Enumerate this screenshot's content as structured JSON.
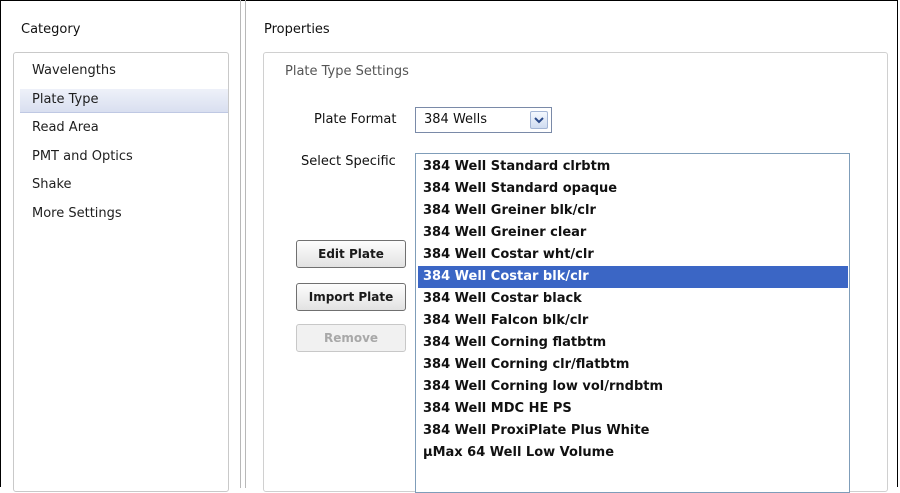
{
  "category": {
    "header": "Category",
    "items": [
      {
        "label": "Wavelengths"
      },
      {
        "label": "Plate Type",
        "selected": true
      },
      {
        "label": "Read Area"
      },
      {
        "label": "PMT and Optics"
      },
      {
        "label": "Shake"
      },
      {
        "label": "More Settings"
      }
    ]
  },
  "properties": {
    "header": "Properties",
    "section_title": "Plate Type Settings",
    "plate_format": {
      "label": "Plate Format",
      "value": "384 Wells",
      "icon": "chevron-down-icon"
    },
    "select_specific": {
      "label": "Select Specific",
      "selected_index": 5,
      "items": [
        "384 Well Standard clrbtm",
        "384 Well Standard opaque",
        "384 Well Greiner blk/clr",
        "384 Well Greiner clear",
        "384 Well Costar wht/clr",
        "384 Well Costar blk/clr",
        "384 Well Costar black",
        "384 Well Falcon blk/clr",
        "384 Well Corning flatbtm",
        "384 Well Corning clr/flatbtm",
        "384 Well Corning low vol/rndbtm",
        "384 Well MDC HE PS",
        "384 Well ProxiPlate Plus White",
        "µMax 64 Well Low Volume"
      ]
    },
    "buttons": {
      "edit_plate": "Edit Plate",
      "import_plate": "Import Plate",
      "remove": "Remove",
      "remove_enabled": false
    }
  },
  "colors": {
    "selection": "#3b66c5",
    "category_selection": "#d9dff0"
  }
}
